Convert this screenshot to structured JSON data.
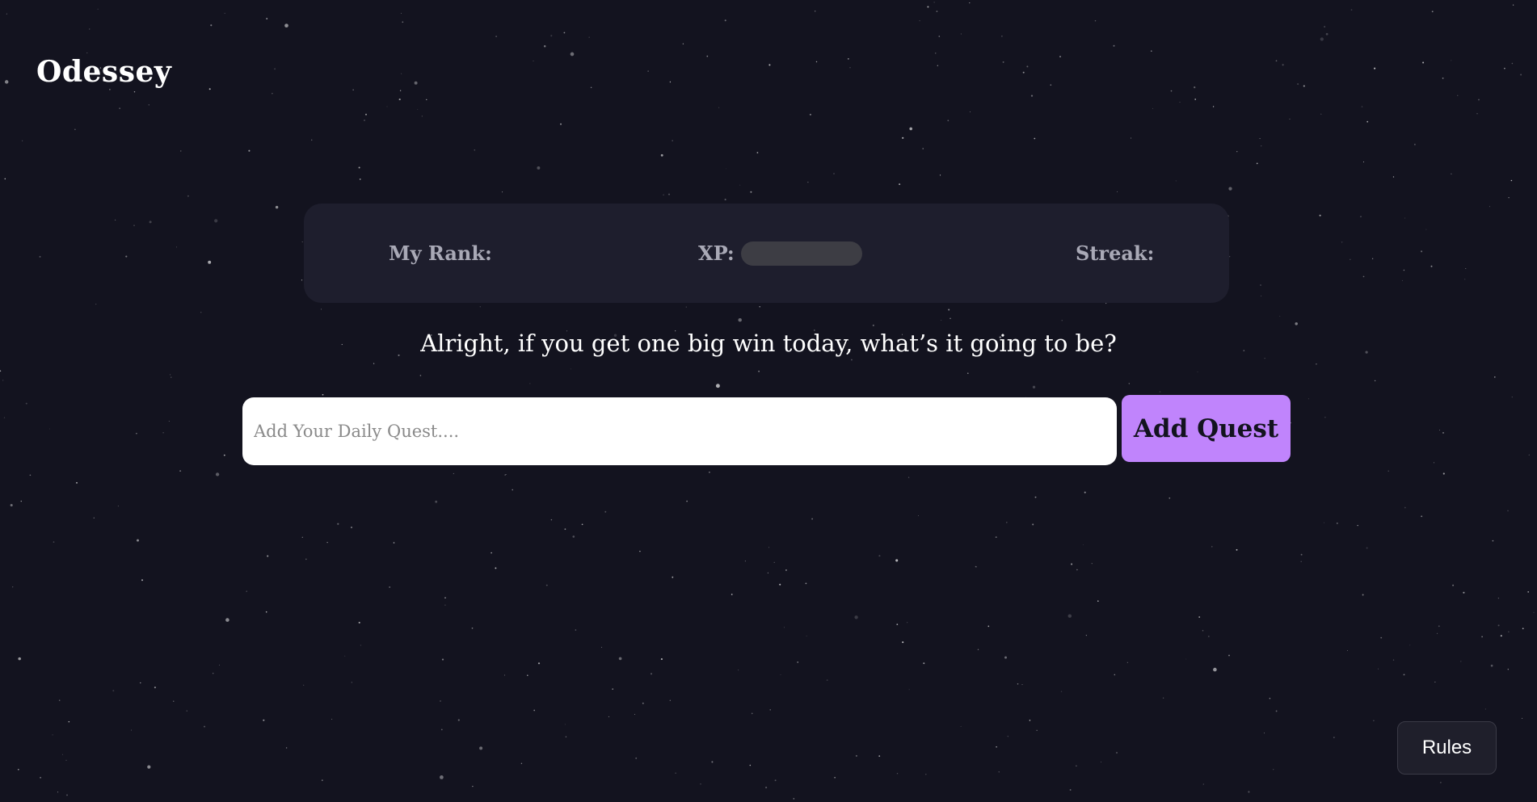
{
  "app": {
    "brand": "Odessey"
  },
  "stats": {
    "rank_label": "My Rank:",
    "xp_label": "XP:",
    "xp_progress": 0,
    "streak_label": "Streak:"
  },
  "main": {
    "prompt": "Alright, if you get one big win today, what’s it going to be?",
    "quest_input": {
      "value": "",
      "placeholder": "Add Your Daily Quest...."
    },
    "add_button_label": "Add Quest"
  },
  "footer": {
    "rules_label": "Rules"
  },
  "colors": {
    "background": "#13131f",
    "card": "#1e1e2d",
    "accent": "#c084fc",
    "muted_text": "#a9a9b6",
    "xp_track": "#3d3d44"
  }
}
